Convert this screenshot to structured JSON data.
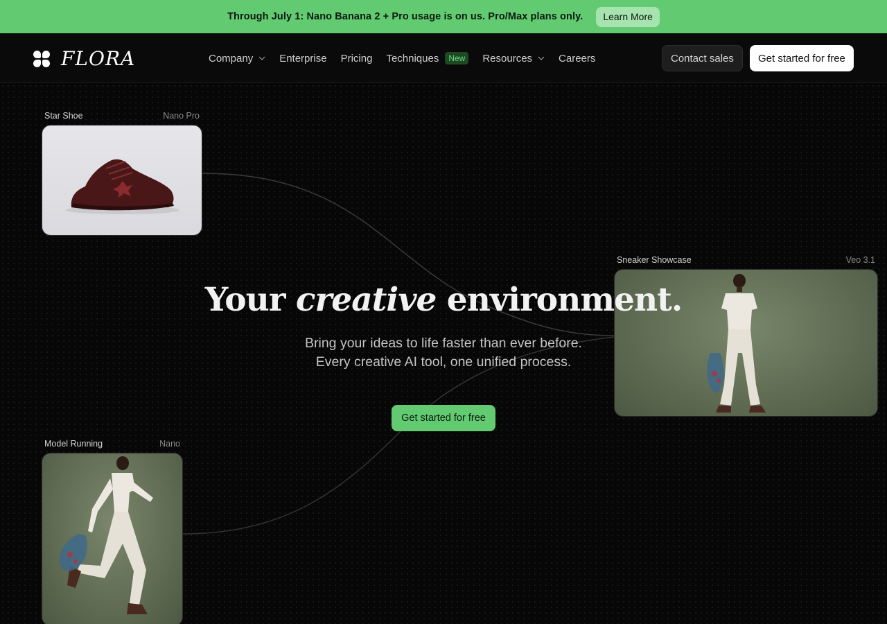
{
  "banner": {
    "text": "Through July 1: Nano Banana 2 + Pro usage is on us. Pro/Max plans only.",
    "button": "Learn More"
  },
  "nav": {
    "logo_text": "FLORA",
    "links": [
      {
        "label": "Company",
        "has_dropdown": true
      },
      {
        "label": "Enterprise"
      },
      {
        "label": "Pricing"
      },
      {
        "label": "Techniques",
        "badge": "New"
      },
      {
        "label": "Resources",
        "has_dropdown": true
      },
      {
        "label": "Careers"
      }
    ],
    "contact_sales": "Contact sales",
    "get_started": "Get started for free"
  },
  "hero": {
    "title_pre": "Your",
    "title_em": "creative",
    "title_post": "environment.",
    "subtitle_line1": "Bring your ideas to life faster than ever before.",
    "subtitle_line2": "Every creative AI tool, one unified process.",
    "cta": "Get started for free"
  },
  "cards": [
    {
      "title": "Star Shoe",
      "model": "Nano Pro"
    },
    {
      "title": "Sneaker Showcase",
      "model": "Veo 3.1"
    },
    {
      "title": "Model Running",
      "model": "Nano"
    }
  ],
  "colors": {
    "accent_green": "#62cb72",
    "background": "#070707"
  }
}
